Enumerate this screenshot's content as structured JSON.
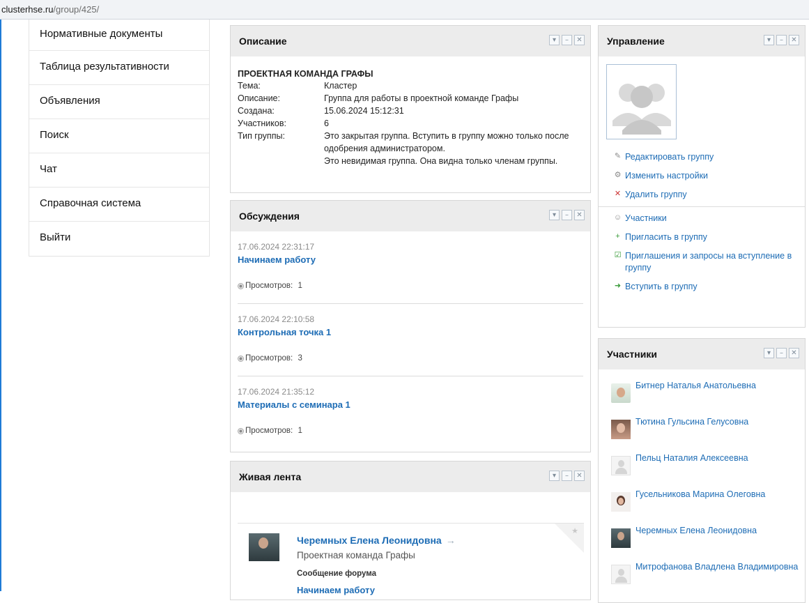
{
  "browser": {
    "url_host": "clusterhse.ru",
    "url_path": "/group/425/"
  },
  "nav": {
    "items": [
      {
        "label": "Нормативные документы"
      },
      {
        "label": "Таблица результативности"
      },
      {
        "label": "Объявления"
      },
      {
        "label": "Поиск"
      },
      {
        "label": "Чат"
      },
      {
        "label": "Справочная система"
      },
      {
        "label": "Выйти"
      }
    ]
  },
  "widget_controls": {
    "collapse": "▾",
    "minimize": "–",
    "close": "✕"
  },
  "description": {
    "title": "Описание",
    "group_name": "ПРОЕКТНАЯ КОМАНДА ГРАФЫ",
    "rows": [
      {
        "key": "Тема:",
        "value": "Кластер"
      },
      {
        "key": "Описание:",
        "value": "Группа для работы в проектной команде Графы"
      },
      {
        "key": "Создана:",
        "value": "15.06.2024 15:12:31"
      },
      {
        "key": "Участников:",
        "value": "6"
      },
      {
        "key": "Тип группы:",
        "value": "Это закрытая группа. Вступить в группу можно только после одобрения администратором."
      },
      {
        "key": "",
        "value": "Это невидимая группа. Она видна только членам группы."
      }
    ]
  },
  "discussions": {
    "title": "Обсуждения",
    "views_label": "Просмотров:",
    "items": [
      {
        "date": "17.06.2024 22:31:17",
        "title": "Начинаем работу",
        "views": "1"
      },
      {
        "date": "17.06.2024 22:10:58",
        "title": "Контрольная точка 1",
        "views": "3"
      },
      {
        "date": "17.06.2024 21:35:12",
        "title": "Материалы с семинара 1",
        "views": "1"
      }
    ]
  },
  "feed": {
    "title": "Живая лента",
    "author": "Черемных Елена Леонидовна",
    "arrow": "→",
    "group": "Проектная команда Графы",
    "type": "Сообщение форума",
    "link": "Начинаем работу",
    "star": "★"
  },
  "management": {
    "title": "Управление",
    "links_1": [
      {
        "label": "Редактировать группу",
        "icon": "edit-icon"
      },
      {
        "label": "Изменить настройки",
        "icon": "settings-icon"
      },
      {
        "label": "Удалить группу",
        "icon": "delete-group-icon"
      }
    ],
    "links_2": [
      {
        "label": "Участники",
        "icon": "members-icon"
      },
      {
        "label": "Пригласить в группу",
        "icon": "invite-icon"
      },
      {
        "label": "Приглашения и запросы на вступление в группу",
        "icon": "requests-icon"
      },
      {
        "label": "Вступить в группу",
        "icon": "join-icon"
      }
    ]
  },
  "members": {
    "title": "Участники",
    "items": [
      {
        "name": "Битнер Наталья Анатольевна"
      },
      {
        "name": "Тютина Гульсина Гелусовна"
      },
      {
        "name": "Пельц Наталия Алексеевна"
      },
      {
        "name": "Гусельникова Марина Олеговна"
      },
      {
        "name": "Черемных Елена Леонидовна"
      },
      {
        "name": "Митрофанова Владлена Владимировна"
      }
    ]
  }
}
